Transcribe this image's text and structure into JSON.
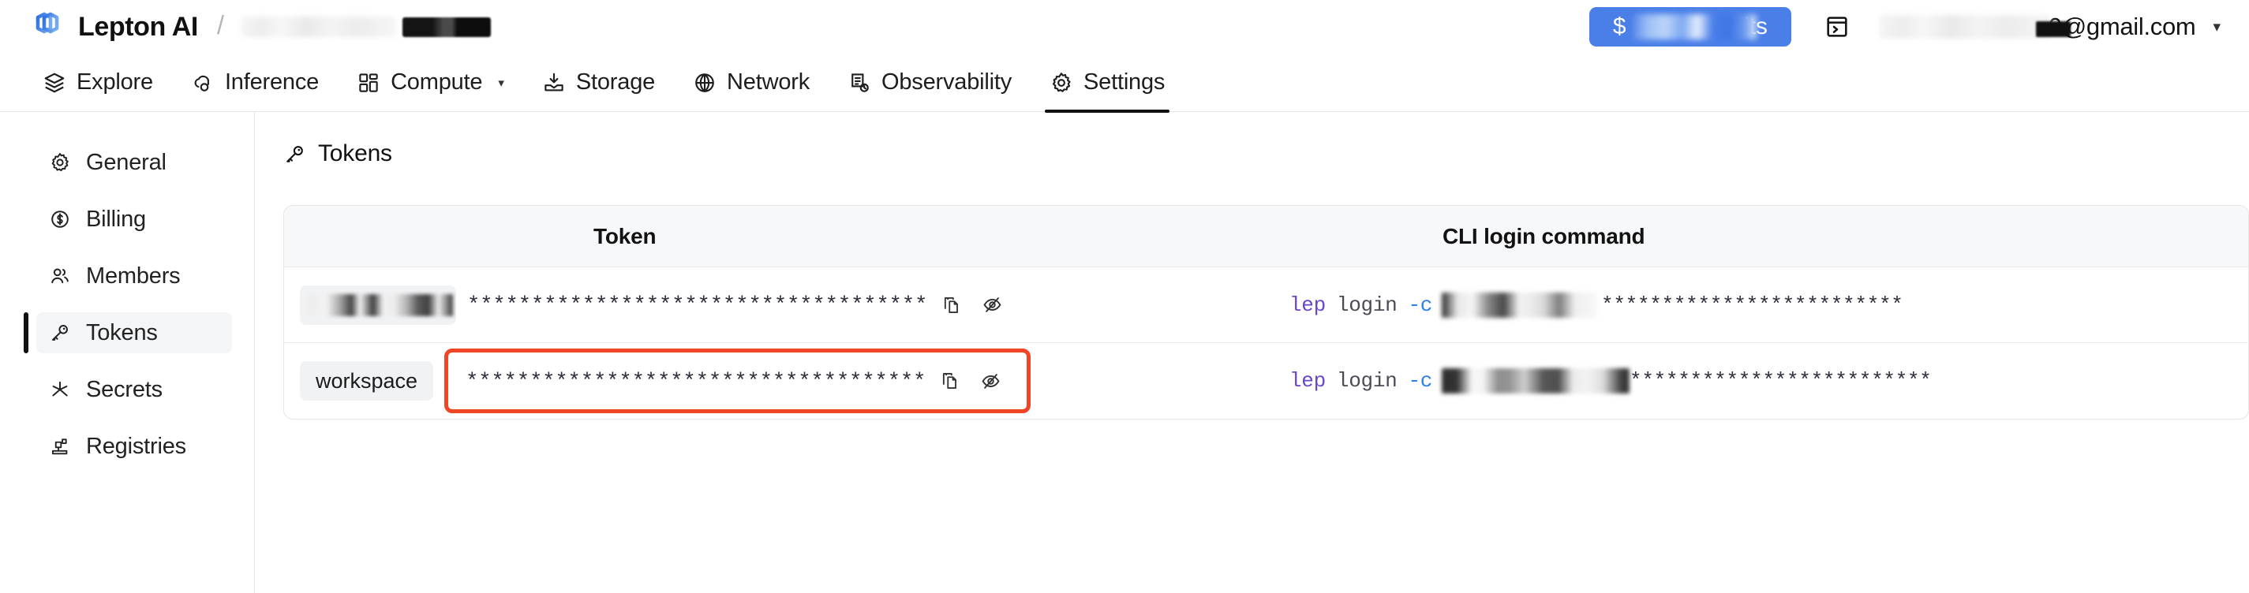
{
  "header": {
    "logo_icon": "lepton-logo-icon",
    "brand": "Lepton AI",
    "breadcrumb_separator": "/",
    "breadcrumb_workspace_redacted": "",
    "breadcrumb_id_redacted": "",
    "credits_button": {
      "prefix": "$",
      "suffix": "its",
      "full_label": "$████ credits",
      "bg_color": "#4a7fe8",
      "text_color": "#ffffff"
    },
    "terminal_icon": "terminal-icon",
    "user_email_suffix": "0@gmail.com",
    "user_menu_caret": "▾"
  },
  "nav": {
    "items": [
      {
        "label": "Explore",
        "icon": "layers-icon",
        "active": false,
        "has_caret": false
      },
      {
        "label": "Inference",
        "icon": "cloud-node-icon",
        "active": false,
        "has_caret": false
      },
      {
        "label": "Compute",
        "icon": "grid-blocks-icon",
        "active": false,
        "has_caret": true
      },
      {
        "label": "Storage",
        "icon": "inbox-download-icon",
        "active": false,
        "has_caret": false
      },
      {
        "label": "Network",
        "icon": "globe-icon",
        "active": false,
        "has_caret": false
      },
      {
        "label": "Observability",
        "icon": "document-clock-icon",
        "active": false,
        "has_caret": false
      },
      {
        "label": "Settings",
        "icon": "gear-icon",
        "active": true,
        "has_caret": false
      }
    ],
    "caret_glyph": "▾",
    "active_underline_color": "#111111"
  },
  "sidebar": {
    "items": [
      {
        "label": "General",
        "icon": "gear-icon",
        "active": false
      },
      {
        "label": "Billing",
        "icon": "dollar-circle-icon",
        "active": false
      },
      {
        "label": "Members",
        "icon": "users-icon",
        "active": false
      },
      {
        "label": "Tokens",
        "icon": "key-icon",
        "active": true
      },
      {
        "label": "Secrets",
        "icon": "asterisk-icon",
        "active": false
      },
      {
        "label": "Registries",
        "icon": "registry-icon",
        "active": false
      }
    ],
    "active_indicator_color": "#111111",
    "active_bg_color": "#f4f5f7"
  },
  "main": {
    "panel": {
      "icon": "key-icon",
      "title": "Tokens"
    },
    "table": {
      "columns": [
        "Token",
        "CLI login command"
      ],
      "rows": [
        {
          "badge_label": "",
          "badge_redacted": true,
          "token_masked": "************************************",
          "copy_icon": "copy-icon",
          "hide_icon": "eye-off-icon",
          "highlighted": false,
          "cli": {
            "program": "lep",
            "command": "login",
            "flag": "-c",
            "arg_redacted": "",
            "token_masked": "*************************"
          }
        },
        {
          "badge_label": "workspace",
          "badge_redacted": false,
          "token_masked": "************************************",
          "copy_icon": "copy-icon",
          "hide_icon": "eye-off-icon",
          "highlighted": true,
          "highlight_color": "#f04526",
          "cli": {
            "program": "lep",
            "command": "login",
            "flag": "-c",
            "arg_redacted": "",
            "token_masked": "*************************"
          }
        }
      ]
    }
  }
}
